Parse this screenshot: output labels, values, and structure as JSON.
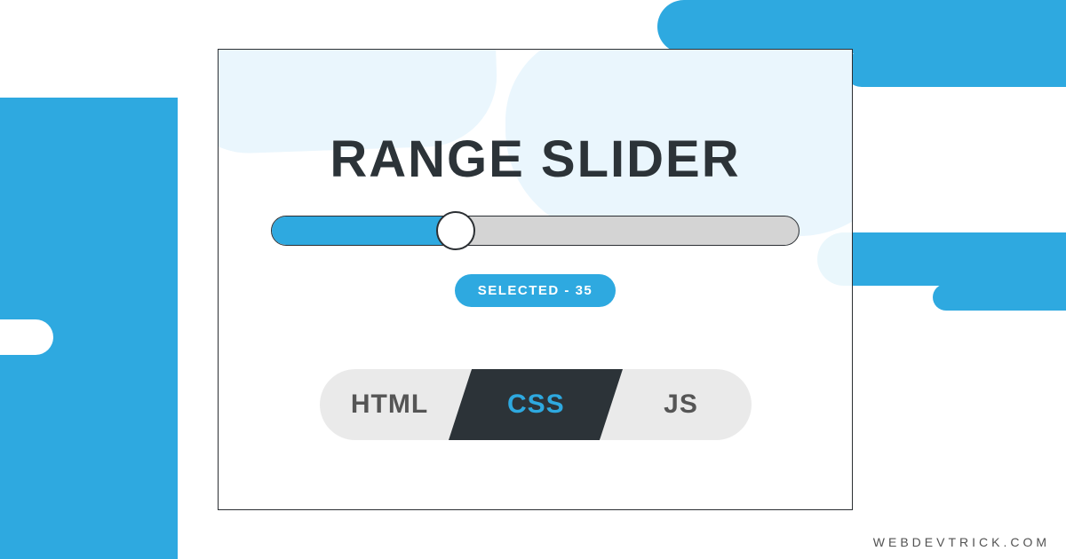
{
  "title": "RANGE SLIDER",
  "slider": {
    "value": 35,
    "min": 0,
    "max": 100,
    "selected_label": "SELECTED - 35"
  },
  "tabs": {
    "left": "HTML",
    "mid": "CSS",
    "right": "JS",
    "active": "CSS"
  },
  "site_label": "WEBDEVTRICK.COM",
  "colors": {
    "accent": "#2ea9e0",
    "dark": "#2c3338",
    "track_bg": "#d4d4d4",
    "light_blob": "#eaf6fd"
  }
}
